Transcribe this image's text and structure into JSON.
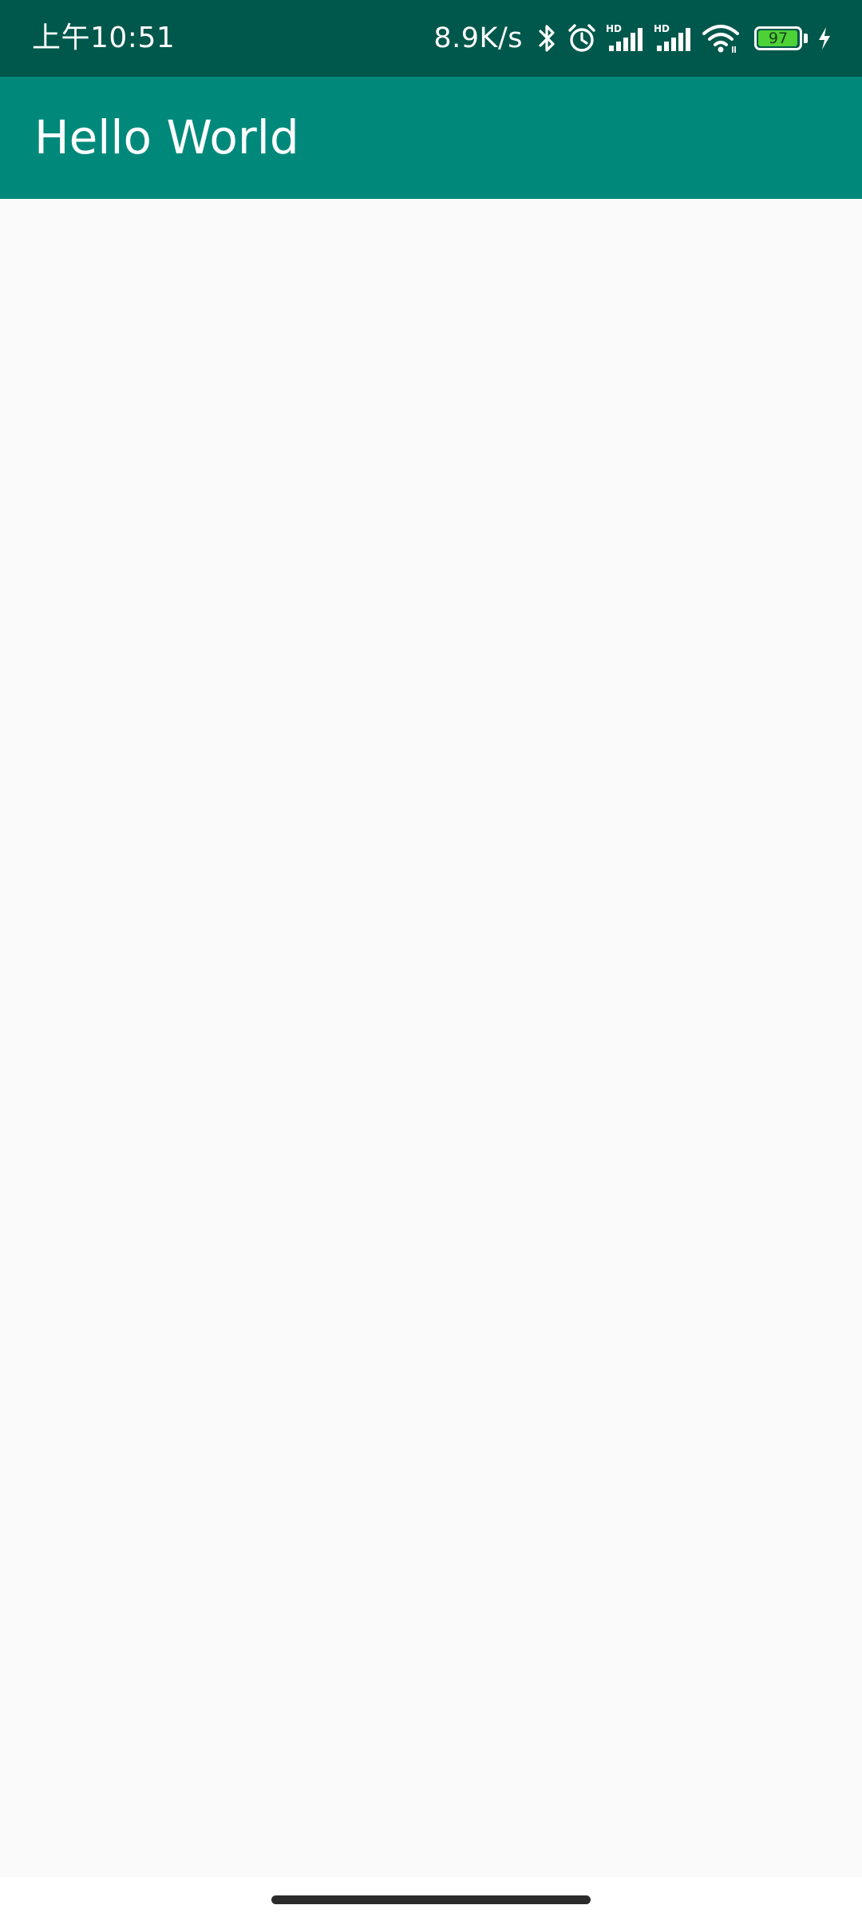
{
  "status_bar": {
    "time": "上午10:51",
    "net_speed": "8.9K/s",
    "icons": [
      "bluetooth-icon",
      "alarm-icon",
      "hd-signal-icon",
      "hd-signal-icon",
      "wifi-icon",
      "battery-icon",
      "charging-icon"
    ],
    "signal_badge_1": "HD",
    "signal_badge_2": "HD",
    "battery_level": "97",
    "battery_fraction": 0.97
  },
  "app_bar": {
    "title": "Hello World"
  },
  "colors": {
    "status_bar": "#00574b",
    "app_bar": "#00897b",
    "background": "#fafafa",
    "battery_fill": "#4cd137"
  }
}
